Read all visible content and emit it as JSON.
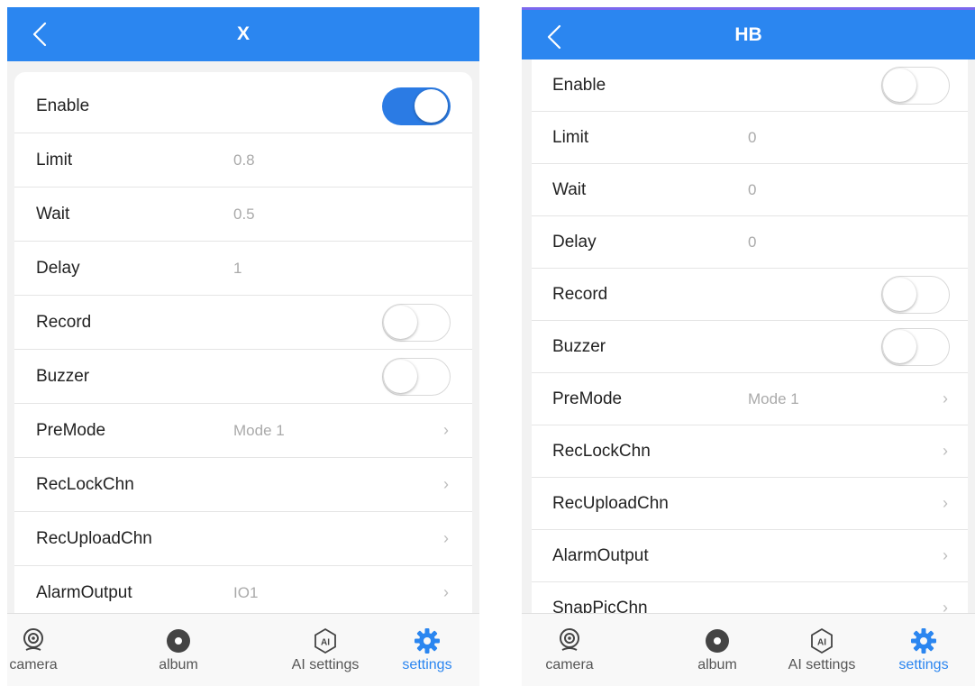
{
  "colors": {
    "accent": "#2b86f0",
    "toggle_on": "#2b7be4",
    "muted": "#aaaaaa"
  },
  "screens": [
    {
      "title": "X",
      "rows": [
        {
          "label": "Enable",
          "type": "toggle",
          "on": true
        },
        {
          "label": "Limit",
          "value": "0.8"
        },
        {
          "label": "Wait",
          "value": "0.5"
        },
        {
          "label": "Delay",
          "value": "1"
        },
        {
          "label": "Record",
          "type": "toggle",
          "on": false
        },
        {
          "label": "Buzzer",
          "type": "toggle",
          "on": false
        },
        {
          "label": "PreMode",
          "value": "Mode 1",
          "chevron": "›"
        },
        {
          "label": "RecLockChn",
          "chevron": "›"
        },
        {
          "label": "RecUploadChn",
          "chevron": "›"
        },
        {
          "label": "AlarmOutput",
          "value": "IO1",
          "chevron": "›"
        }
      ]
    },
    {
      "title": "HB",
      "rows": [
        {
          "label": "Enable",
          "type": "toggle",
          "on": false
        },
        {
          "label": "Limit",
          "value": "0"
        },
        {
          "label": "Wait",
          "value": "0"
        },
        {
          "label": "Delay",
          "value": "0"
        },
        {
          "label": "Record",
          "type": "toggle",
          "on": false
        },
        {
          "label": "Buzzer",
          "type": "toggle",
          "on": false
        },
        {
          "label": "PreMode",
          "value": "Mode 1",
          "chevron": "›"
        },
        {
          "label": "RecLockChn",
          "chevron": "›"
        },
        {
          "label": "RecUploadChn",
          "chevron": "›"
        },
        {
          "label": "AlarmOutput",
          "chevron": "›"
        },
        {
          "label": "SnapPicChn",
          "chevron": "›"
        }
      ]
    }
  ],
  "tabs": [
    {
      "label": "camera",
      "icon": "camera-icon"
    },
    {
      "label": "album",
      "icon": "album-icon"
    },
    {
      "label": "AI settings",
      "icon": "ai-settings-icon",
      "icon_text": "AI"
    },
    {
      "label": "settings",
      "icon": "gear-icon",
      "active": true
    }
  ]
}
